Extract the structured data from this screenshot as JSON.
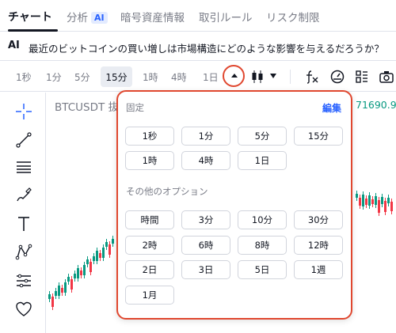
{
  "nav": {
    "tabs": [
      "チャート",
      "分析",
      "暗号資産情報",
      "取引ルール",
      "リスク制限"
    ],
    "ai_badge": "AI"
  },
  "ai_prompt": {
    "logo": "AI",
    "question": "最近のビットコインの買い増しは市場構造にどのような影響を与えるだろうか？"
  },
  "toolbar": {
    "intervals": [
      "1秒",
      "1分",
      "5分",
      "15分",
      "1時",
      "4時",
      "1日"
    ],
    "selected": "15分",
    "icon_names": [
      "caret-up-icon",
      "candlestick-icon",
      "chevron-down-icon",
      "fx-icon",
      "gauge-icon",
      "layout-icon",
      "camera-icon"
    ]
  },
  "chart": {
    "symbol": "BTCUSDT 抜",
    "price": "71690.9",
    "price_color": "#089981",
    "down_color": "#f23645"
  },
  "popup": {
    "pinned_title": "固定",
    "edit_label": "編集",
    "pinned": [
      "1秒",
      "1分",
      "5分",
      "15分",
      "1時",
      "4時",
      "1日"
    ],
    "other_title": "その他のオプション",
    "other": [
      "時間",
      "3分",
      "10分",
      "30分",
      "2時",
      "6時",
      "8時",
      "12時",
      "2日",
      "3日",
      "5日",
      "1週",
      "1月"
    ],
    "border_color": "#e0472f"
  },
  "left_tools": [
    "crosshair-icon",
    "trend-line-icon",
    "fib-lines-icon",
    "brush-icon",
    "text-icon",
    "pattern-icon",
    "forecast-icon",
    "heart-icon"
  ]
}
